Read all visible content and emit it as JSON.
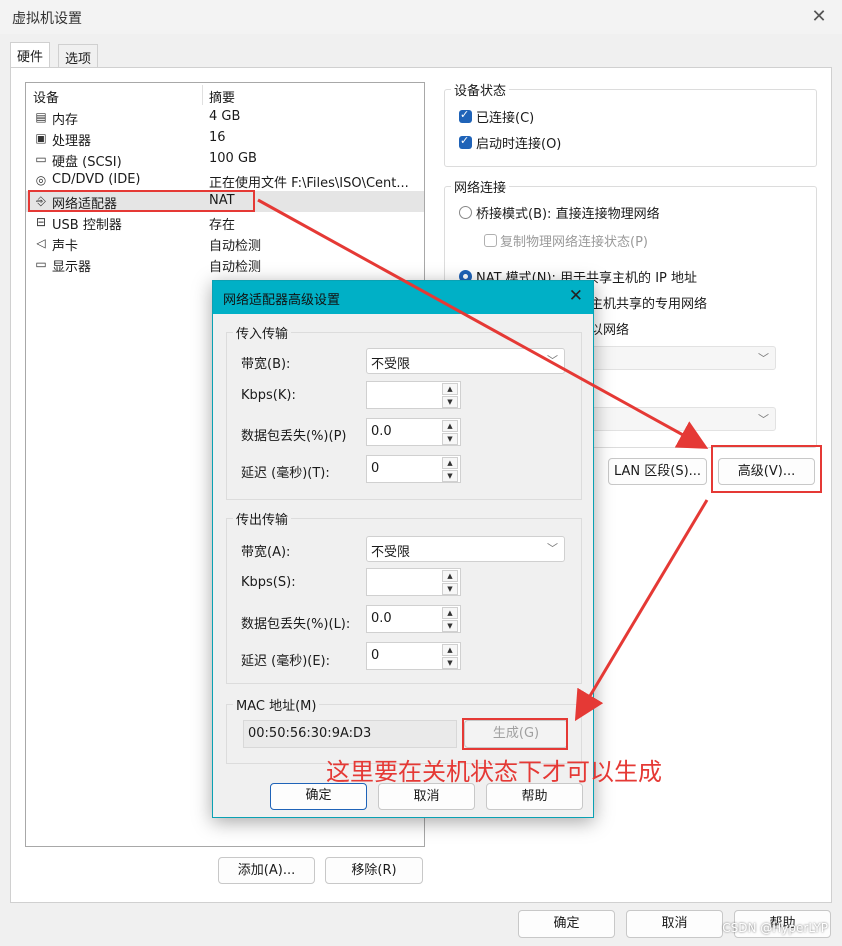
{
  "window": {
    "title": "虚拟机设置"
  },
  "tabs": [
    {
      "label": "硬件"
    },
    {
      "label": "选项"
    }
  ],
  "device_list": {
    "col_device": "设备",
    "col_summary": "摘要",
    "rows": [
      {
        "icon": "memory-icon",
        "name": "内存",
        "summary": "4 GB"
      },
      {
        "icon": "cpu-icon",
        "name": "处理器",
        "summary": "16"
      },
      {
        "icon": "harddisk-icon",
        "name": "硬盘 (SCSI)",
        "summary": "100 GB"
      },
      {
        "icon": "cd-icon",
        "name": "CD/DVD (IDE)",
        "summary": "正在使用文件 F:\\Files\\ISO\\Cent..."
      },
      {
        "icon": "network-icon",
        "name": "网络适配器",
        "summary": "NAT"
      },
      {
        "icon": "usb-icon",
        "name": "USB 控制器",
        "summary": "存在"
      },
      {
        "icon": "speaker-icon",
        "name": "声卡",
        "summary": "自动检测"
      },
      {
        "icon": "monitor-icon",
        "name": "显示器",
        "summary": "自动检测"
      }
    ]
  },
  "buttons": {
    "add": "添加(A)...",
    "remove": "移除(R)",
    "ok": "确定",
    "cancel": "取消",
    "help": "帮助"
  },
  "device_status": {
    "title": "设备状态",
    "connected": "已连接(C)",
    "connect_on_power": "启动时连接(O)"
  },
  "network": {
    "title": "网络连接",
    "bridged": "桥接模式(B): 直接连接物理网络",
    "replicate": "复制物理网络连接状态(P)",
    "nat": "NAT 模式(N): 用于共享主机的 IP 地址",
    "hostonly_partial": "主机共享的专用网络",
    "custom_partial": "以网络",
    "lan_segment_btn": "LAN 区段(S)...",
    "advanced_btn": "高级(V)..."
  },
  "dialog": {
    "title": "网络适配器高级设置",
    "incoming": {
      "title": "传入传输",
      "bandwidth_label": "带宽(B):",
      "bandwidth_value": "不受限",
      "kbps_label": "Kbps(K):",
      "kbps_value": "",
      "loss_label": "数据包丢失(%)(P)",
      "loss_value": "0.0",
      "latency_label": "延迟 (毫秒)(T):",
      "latency_value": "0"
    },
    "outgoing": {
      "title": "传出传输",
      "bandwidth_label": "带宽(A):",
      "bandwidth_value": "不受限",
      "kbps_label": "Kbps(S):",
      "kbps_value": "",
      "loss_label": "数据包丢失(%)(L):",
      "loss_value": "0.0",
      "latency_label": "延迟 (毫秒)(E):",
      "latency_value": "0"
    },
    "mac": {
      "title": "MAC 地址(M)",
      "value": "00:50:56:30:9A:D3",
      "generate_btn": "生成(G)"
    },
    "ok": "确定",
    "cancel": "取消",
    "help": "帮助"
  },
  "annotation": "这里要在关机状态下才可以生成",
  "watermark": "CSDN @HyperLYP",
  "colors": {
    "accent": "#1f63b8",
    "dialog_title": "#00b0c6",
    "annotation_red": "#e53935"
  }
}
